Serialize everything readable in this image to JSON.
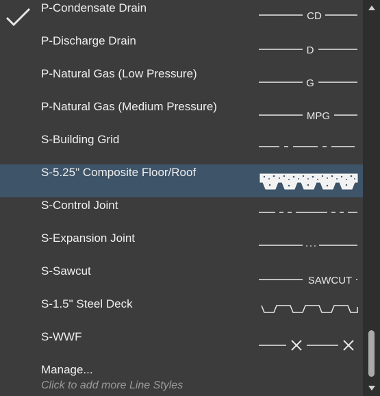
{
  "menu": {
    "items": [
      {
        "label": "P-Condensate Drain",
        "checked": true,
        "swatch": "line-text",
        "swatch_text": "CD"
      },
      {
        "label": "P-Discharge Drain",
        "swatch": "line-text",
        "swatch_text": "D"
      },
      {
        "label": "P-Natural Gas (Low Pressure)",
        "swatch": "line-text",
        "swatch_text": "G"
      },
      {
        "label": "P-Natural Gas (Medium Pressure)",
        "swatch": "line-text",
        "swatch_text": "MPG"
      },
      {
        "label": "S-Building Grid",
        "swatch": "dash-dot"
      },
      {
        "label": "S-5.25\" Composite Floor/Roof",
        "selected": true,
        "swatch": "composite-floor"
      },
      {
        "label": "S-Control Joint",
        "swatch": "dash-dot-dot"
      },
      {
        "label": "S-Expansion Joint",
        "swatch": "line-dots"
      },
      {
        "label": "S-Sawcut",
        "swatch": "line-text",
        "swatch_text": "SAWCUT"
      },
      {
        "label": "S-1.5\" Steel Deck",
        "swatch": "steel-deck"
      },
      {
        "label": "S-WWF",
        "swatch": "line-x"
      }
    ],
    "manage_label": "Manage...",
    "hint": "Click to add more Line Styles"
  },
  "colors": {
    "background": "#3c3c3c",
    "selected_row": "#3e5469",
    "text": "#eeeeee",
    "hint_text": "#9a9a9a",
    "scrollbar_track": "#2e2e2e",
    "scrollbar_thumb": "#a9a9a9"
  },
  "icons": {
    "checked": "checkmark-icon",
    "scroll_up": "triangle-up-icon",
    "scroll_down": "triangle-down-icon"
  }
}
